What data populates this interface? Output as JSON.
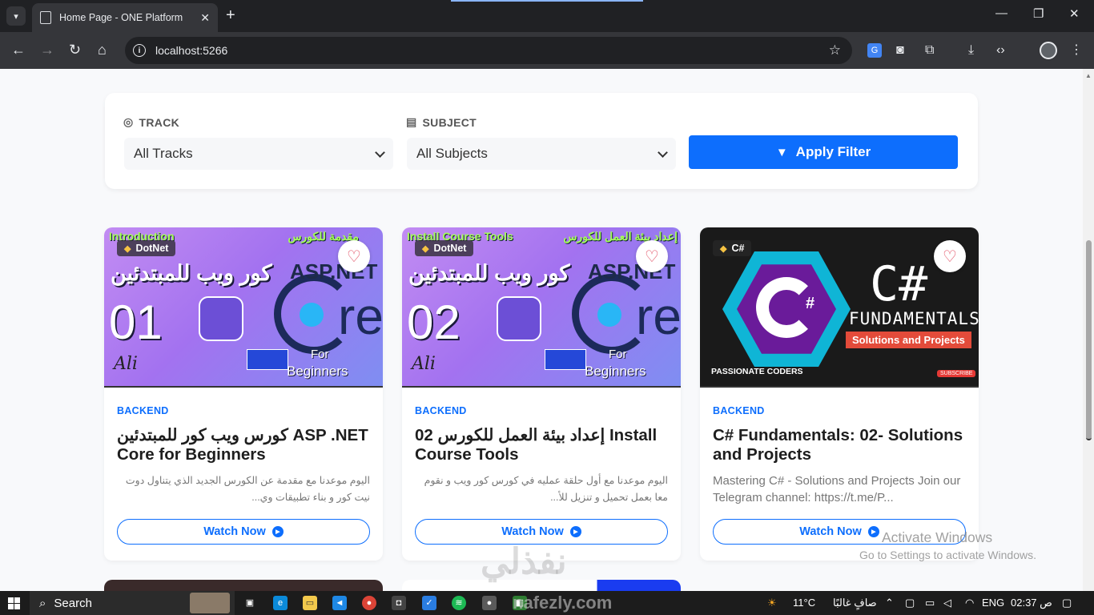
{
  "browser": {
    "tab_title": "Home Page - ONE Platform",
    "tab_close": "✕",
    "new_tab": "+",
    "url": "localhost:5266",
    "window_controls": {
      "minimize": "—",
      "maximize": "❐",
      "close": "✕"
    }
  },
  "filters": {
    "track_label": "TRACK",
    "track_value": "All Tracks",
    "subject_label": "SUBJECT",
    "subject_value": "All Subjects",
    "apply_label": "Apply Filter"
  },
  "courses": [
    {
      "tag": "DotNet",
      "category": "BACKEND",
      "title": "كورس ويب كور للمبتدئين ASP .NET Core for Beginners",
      "description": "اليوم موعدنا مع مقدمة عن الكورس الجديد الذي يتناول دوت نيت كور و بناء تطبيقات وي...",
      "watch_label": "Watch Now",
      "thumb": {
        "top_left": "Introduction",
        "top_right": "مقدمة للكورس",
        "arabic": "كور ويب للمبتدئين",
        "number": "01",
        "asp": "ASP.NET",
        "core": "re",
        "for": "For",
        "beginners": "Beginners",
        "signature": "Ali"
      }
    },
    {
      "tag": "DotNet",
      "category": "BACKEND",
      "title": "إعداد بيئة العمل للكورس 02 Install Course Tools",
      "description": "اليوم موعدنا مع أول حلقة عمليه في كورس كور ويب و نقوم معا بعمل تحميل و تنزيل للأ...",
      "watch_label": "Watch Now",
      "thumb": {
        "top_left": "Install Course Tools",
        "top_right": "إعداد بيئة العمل للكورس",
        "arabic": "كور ويب للمبتدئين",
        "number": "02",
        "asp": "ASP.NET",
        "core": "re",
        "for": "For",
        "beginners": "Beginners",
        "signature": "Ali"
      }
    },
    {
      "tag": "C#",
      "category": "BACKEND",
      "title": "C# Fundamentals: 02- Solutions and Projects",
      "description": "Mastering C# - Solutions and Projects Join our Telegram channel: https://t.me/P...",
      "watch_label": "Watch Now",
      "thumb": {
        "c_hash": "#",
        "cs_title": "C#",
        "fundamentals": "FUNDAMENTALS",
        "solutions": "Solutions and Projects",
        "brand": "PASSIONATE CODERS",
        "subscribe": "SUBSCRIBE"
      }
    }
  ],
  "overlay": {
    "activate_title": "Activate Windows",
    "activate_sub": "Go to Settings to activate Windows.",
    "watermark": "نفذلي"
  },
  "taskbar": {
    "search_label": "Search",
    "weather": "11°C",
    "weather_desc": "صافٍ غالبًا",
    "lang": "ENG",
    "time": "02:37 ص",
    "site": "nafezly.com"
  },
  "colors": {
    "accent": "#0d6efd",
    "heart": "#e0455b",
    "tag_icon": "#f6c343"
  },
  "icons": {
    "track": "target-icon",
    "subject": "book-icon",
    "apply": "filter-funnel-icon",
    "tag": "tag-icon",
    "favorite": "heart-icon",
    "watch": "play-circle-icon"
  }
}
